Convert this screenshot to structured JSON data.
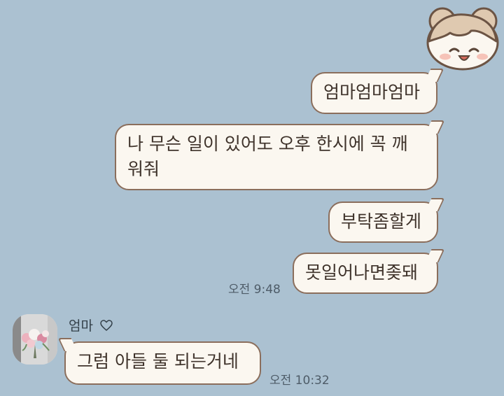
{
  "chat": {
    "background_color": "#abc1d1",
    "bubble_color": "#fbf7f0",
    "bubble_border_color": "#8b6e5c",
    "time_color": "#4e5c68",
    "sent_messages": [
      {
        "text": "엄마엄마엄마"
      },
      {
        "text": "나 무슨 일이 있어도 오후 한시에 꼭 깨\n워줘"
      },
      {
        "text": "부탁좀할게"
      },
      {
        "text": "못일어나면좆돼"
      }
    ],
    "sent_time": "오전 9:48",
    "received": {
      "sender_name": "엄마",
      "sender_icon": "heart-outline-icon",
      "messages": [
        {
          "text": "그럼 아들 둘 되는거네"
        }
      ],
      "time": "오전 10:32"
    },
    "my_profile_icon": "bear-face-sticker-icon",
    "sender_avatar_icon": "flower-bouquet-photo-icon"
  }
}
